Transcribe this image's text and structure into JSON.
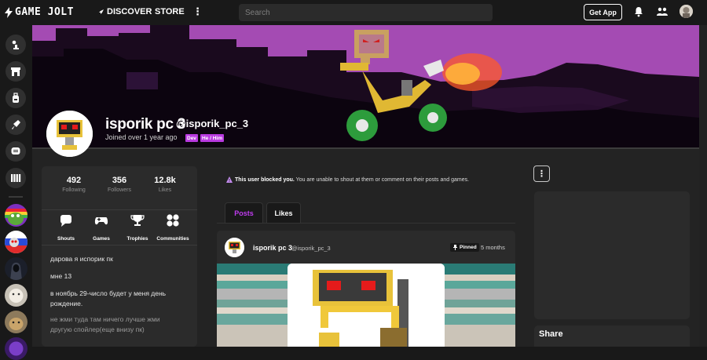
{
  "topbar": {
    "logo_text": "GAME JOLT",
    "discover": "DISCOVER",
    "store": "STORE",
    "more": "⋮",
    "search_placeholder": "Search",
    "get_app": "Get App"
  },
  "profile": {
    "name": "isporik pc 3",
    "handle": "@isporik_pc_3",
    "joined": "Joined over 1 year ago",
    "tags": [
      "Dev",
      "He / Him"
    ],
    "stats": [
      {
        "value": "492",
        "label": "Following"
      },
      {
        "value": "356",
        "label": "Followers"
      },
      {
        "value": "12.8k",
        "label": "Likes"
      }
    ],
    "actions": [
      "Shouts",
      "Games",
      "Trophies",
      "Communities"
    ],
    "bio": [
      "дарова я испорик пк",
      "мне 13",
      "в ноябрь 29-число будет у меня день рождение.",
      "не жми туда там ничего лучше жми",
      "другую спойлер(еще внизу пк)"
    ]
  },
  "notice": {
    "bold": "This user blocked you.",
    "text": " You are unable to shout at them or comment on their posts and games."
  },
  "tabs": {
    "posts": "Posts",
    "likes": "Likes"
  },
  "post": {
    "author": "isporik pc 3",
    "handle": "@isporik_pc_3",
    "pinned": "Pinned",
    "time": "5 months"
  },
  "sidebar_right": {
    "menu": "⋮",
    "share": "Share"
  },
  "colors": {
    "accent": "#c03cf0",
    "banner": "#a44bb3",
    "tag": "#b93ae0"
  }
}
